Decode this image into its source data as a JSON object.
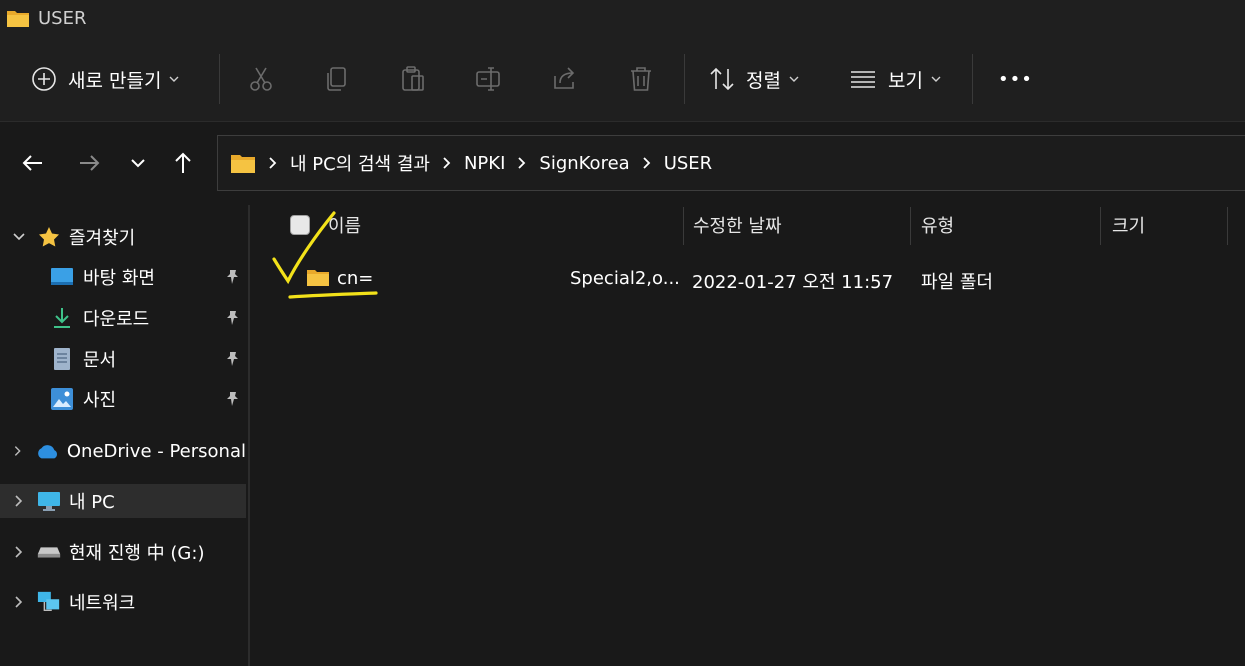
{
  "window": {
    "title": "USER"
  },
  "toolbar": {
    "new_label": "새로 만들기",
    "sort_label": "정렬",
    "view_label": "보기",
    "more_label": "•••"
  },
  "breadcrumb": [
    "내 PC의 검색 결과",
    "NPKI",
    "SignKorea",
    "USER"
  ],
  "sidebar": {
    "favorites": {
      "label": "즐겨찾기",
      "items": [
        "바탕 화면",
        "다운로드",
        "문서",
        "사진"
      ]
    },
    "onedrive": "OneDrive - Personal",
    "this_pc": "내 PC",
    "drive": "현재 진행 中 (G:)",
    "network": "네트워크"
  },
  "columns": [
    "이름",
    "수정한 날짜",
    "유형",
    "크기"
  ],
  "rows": [
    {
      "name": "cn=",
      "name_tail": "Special2,o...",
      "modified": "2022-01-27 오전 11:57",
      "type": "파일 폴더",
      "size": ""
    }
  ],
  "colors": {
    "background": "#191919",
    "toolbar": "#1f1f1f",
    "folder": "#f5c342",
    "annotation": "#f3e21a",
    "selected": "#2d2d2d"
  }
}
